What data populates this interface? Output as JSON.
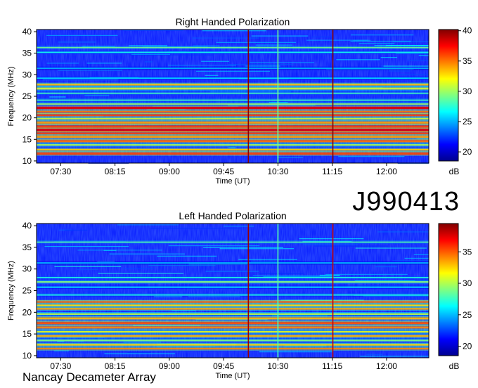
{
  "observation_id": "J990413",
  "footer": "Nancay Decameter Array",
  "chart_data": [
    {
      "type": "heatmap",
      "title": "Right Handed Polarization",
      "xlabel": "Time (UT)",
      "ylabel": "Frequency (MHz)",
      "x_ticks": [
        "07:30",
        "08:15",
        "09:00",
        "09:45",
        "10:30",
        "11:15",
        "12:00"
      ],
      "x_tick_minutes": [
        450,
        495,
        540,
        585,
        630,
        675,
        720
      ],
      "xlim_minutes": [
        430,
        755
      ],
      "y_ticks": [
        10,
        15,
        20,
        25,
        30,
        35,
        40
      ],
      "ylim": [
        9.5,
        40.5
      ],
      "colorbar": {
        "label": "dB",
        "ticks": [
          20,
          25,
          30,
          35,
          40
        ],
        "range": [
          18.5,
          40.2
        ]
      },
      "bands": [
        {
          "f": 11.7,
          "w": 0.5,
          "v": 36
        },
        {
          "f": 12.6,
          "w": 0.4,
          "v": 33
        },
        {
          "f": 13.7,
          "w": 0.4,
          "v": 30
        },
        {
          "f": 14.6,
          "w": 0.5,
          "v": 35
        },
        {
          "f": 15.6,
          "w": 0.5,
          "v": 34
        },
        {
          "f": 16.4,
          "w": 0.4,
          "v": 36
        },
        {
          "f": 17.2,
          "w": 0.6,
          "v": 38
        },
        {
          "f": 18.0,
          "w": 0.5,
          "v": 36
        },
        {
          "f": 18.9,
          "w": 0.5,
          "v": 34
        },
        {
          "f": 19.8,
          "w": 0.4,
          "v": 31
        },
        {
          "f": 20.6,
          "w": 0.4,
          "v": 36
        },
        {
          "f": 21.4,
          "w": 0.4,
          "v": 35
        },
        {
          "f": 22.3,
          "w": 0.5,
          "v": 38
        },
        {
          "f": 23.2,
          "w": 0.3,
          "v": 30
        },
        {
          "f": 24.1,
          "w": 0.3,
          "v": 28
        },
        {
          "f": 25.7,
          "w": 0.3,
          "v": 28
        },
        {
          "f": 26.8,
          "w": 0.5,
          "v": 31
        },
        {
          "f": 27.7,
          "w": 0.4,
          "v": 33
        },
        {
          "f": 29.2,
          "w": 0.3,
          "v": 26
        },
        {
          "f": 31.5,
          "w": 0.3,
          "v": 25
        },
        {
          "f": 35.2,
          "w": 0.3,
          "v": 27
        },
        {
          "f": 36.3,
          "w": 0.3,
          "v": 29
        }
      ],
      "vlines_minutes": [
        {
          "t": 605.5,
          "v": 40
        },
        {
          "t": 630,
          "v": 29
        },
        {
          "t": 675.5,
          "v": 40
        }
      ]
    },
    {
      "type": "heatmap",
      "title": "Left Handed Polarization",
      "xlabel": "Time (UT)",
      "ylabel": "Frequency (MHz)",
      "x_ticks": [
        "07:30",
        "08:15",
        "09:00",
        "09:45",
        "10:30",
        "11:15",
        "12:00"
      ],
      "x_tick_minutes": [
        450,
        495,
        540,
        585,
        630,
        675,
        720
      ],
      "xlim_minutes": [
        430,
        755
      ],
      "y_ticks": [
        10,
        15,
        20,
        25,
        30,
        35,
        40
      ],
      "ylim": [
        9.5,
        40.5
      ],
      "colorbar": {
        "label": "dB",
        "ticks": [
          20,
          25,
          30,
          35
        ],
        "range": [
          18.5,
          39.5
        ]
      },
      "bands": [
        {
          "f": 11.6,
          "w": 0.4,
          "v": 34
        },
        {
          "f": 12.5,
          "w": 0.4,
          "v": 32
        },
        {
          "f": 13.5,
          "w": 0.4,
          "v": 29
        },
        {
          "f": 14.5,
          "w": 0.4,
          "v": 33
        },
        {
          "f": 15.5,
          "w": 0.4,
          "v": 31
        },
        {
          "f": 16.5,
          "w": 0.5,
          "v": 34
        },
        {
          "f": 17.5,
          "w": 0.5,
          "v": 35
        },
        {
          "f": 18.6,
          "w": 0.5,
          "v": 33
        },
        {
          "f": 19.6,
          "w": 0.4,
          "v": 30
        },
        {
          "f": 20.8,
          "w": 0.4,
          "v": 33
        },
        {
          "f": 21.6,
          "w": 0.4,
          "v": 32
        },
        {
          "f": 22.4,
          "w": 0.4,
          "v": 34
        },
        {
          "f": 24.0,
          "w": 0.3,
          "v": 27
        },
        {
          "f": 25.8,
          "w": 0.3,
          "v": 26
        },
        {
          "f": 27.0,
          "w": 0.4,
          "v": 29
        },
        {
          "f": 28.0,
          "w": 0.3,
          "v": 27
        },
        {
          "f": 31.4,
          "w": 0.3,
          "v": 25
        },
        {
          "f": 36.2,
          "w": 0.3,
          "v": 28
        }
      ],
      "vlines_minutes": [
        {
          "t": 605.5,
          "v": 39
        },
        {
          "t": 630,
          "v": 28
        },
        {
          "t": 675.5,
          "v": 38
        }
      ]
    }
  ]
}
